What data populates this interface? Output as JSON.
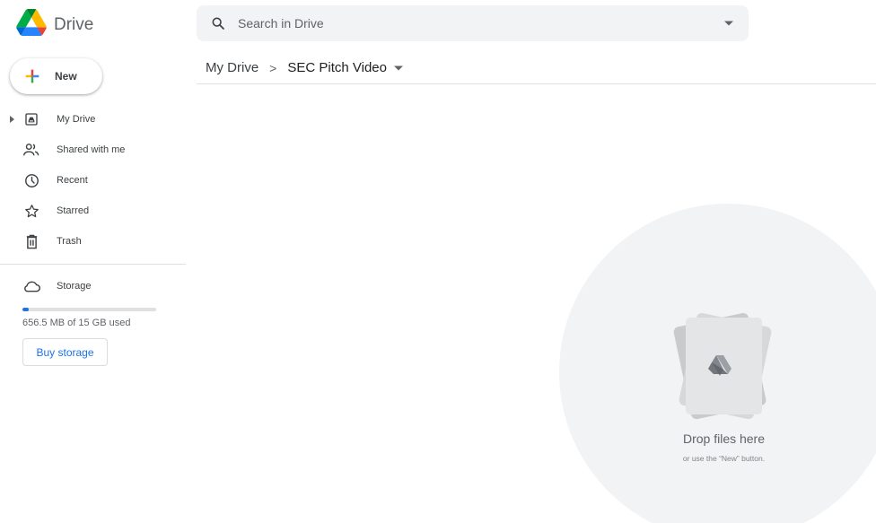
{
  "app": {
    "name": "Drive"
  },
  "search": {
    "placeholder": "Search in Drive",
    "value": ""
  },
  "breadcrumb": {
    "root": "My Drive",
    "separator": ">",
    "current": "SEC Pitch Video"
  },
  "sidebar": {
    "new_label": "New",
    "items": [
      {
        "label": "My Drive",
        "icon": "my-drive-icon",
        "expandable": true
      },
      {
        "label": "Shared with me",
        "icon": "shared-with-me-icon"
      },
      {
        "label": "Recent",
        "icon": "clock-icon"
      },
      {
        "label": "Starred",
        "icon": "star-icon"
      },
      {
        "label": "Trash",
        "icon": "trash-icon"
      }
    ],
    "storage": {
      "label": "Storage",
      "icon": "cloud-icon",
      "used_text": "656.5 MB of 15 GB used",
      "used_fraction": 0.044,
      "buy_label": "Buy storage"
    }
  },
  "drop_zone": {
    "title": "Drop files here",
    "subtitle": "or use the “New” button."
  },
  "colors": {
    "accent": "#1a73e8",
    "search_bg": "#f1f3f4",
    "drop_bg": "#f1f3f4",
    "text_primary": "#3c4043",
    "text_secondary": "#5f6368"
  }
}
